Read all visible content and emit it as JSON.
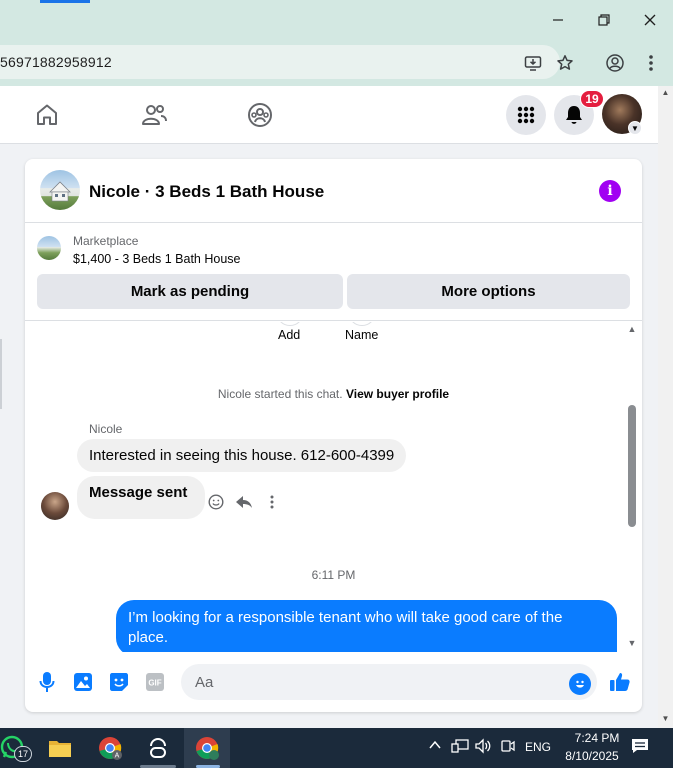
{
  "browser": {
    "url_fragment": "56971882958912"
  },
  "fb_header": {
    "notification_count": "19"
  },
  "chat": {
    "title": "Nicole · 3 Beds 1 Bath House",
    "marketplace": {
      "label": "Marketplace",
      "listing": "$1,400 - 3 Beds 1 Bath House",
      "mark_pending": "Mark as pending",
      "more_options": "More options"
    },
    "profile_actions": {
      "add": "Add",
      "name": "Name"
    },
    "started_text": "Nicole started this chat.",
    "view_buyer_profile": "View buyer profile",
    "sender_name": "Nicole",
    "messages": {
      "incoming_1": "Interested in seeing this house. 612-600-4399",
      "incoming_2": "Message sent",
      "timestamp": "6:11 PM",
      "outgoing_1": "I’m looking for a responsible tenant who will take good care of the place."
    },
    "composer": {
      "placeholder": "Aa"
    }
  },
  "taskbar": {
    "whatsapp_badge": "17",
    "language": "ENG",
    "time": "7:24 PM",
    "date": "8/10/2025"
  },
  "colors": {
    "fb_blue": "#0a7cff",
    "info_purple": "#a100f2",
    "badge_red": "#e41e3f",
    "chrome_bg": "#d3e8e2",
    "taskbar_bg": "#1b2a3b"
  }
}
